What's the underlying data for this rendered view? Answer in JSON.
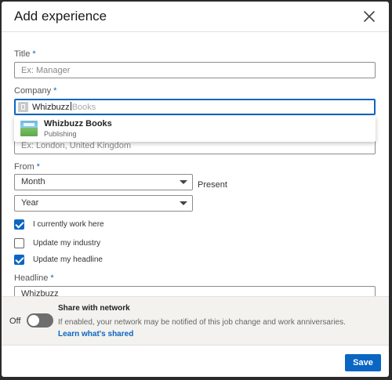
{
  "modal": {
    "title": "Add experience"
  },
  "fields": {
    "title": {
      "label": "Title",
      "required_mark": "*",
      "placeholder": "Ex: Manager"
    },
    "company": {
      "label": "Company",
      "required_mark": "*",
      "typed": "Whizbuzz",
      "suggestion": "Books"
    },
    "location": {
      "value": "Ex: London, United Kingdom"
    },
    "from": {
      "label": "From",
      "required_mark": "*",
      "month": "Month",
      "year": "Year",
      "to_text": "Present"
    },
    "headline": {
      "label": "Headline",
      "required_mark": "*",
      "value": "Whizbuzz"
    }
  },
  "company_dropdown": {
    "name": "Whizbuzz Books",
    "subtitle": "Publishing"
  },
  "checkboxes": [
    {
      "label": "I currently work here",
      "checked": true
    },
    {
      "label": "Update my industry",
      "checked": false
    },
    {
      "label": "Update my headline",
      "checked": true
    }
  ],
  "share": {
    "toggle_state": "Off",
    "title": "Share with network",
    "description": "If enabled, your network may be notified of this job change and work anniversaries.",
    "link": "Learn what's shared"
  },
  "save_label": "Save",
  "colors": {
    "accent": "#0a66c2",
    "toggle_off": "#6e6e6e",
    "footer_bg": "#f3f2ef"
  }
}
